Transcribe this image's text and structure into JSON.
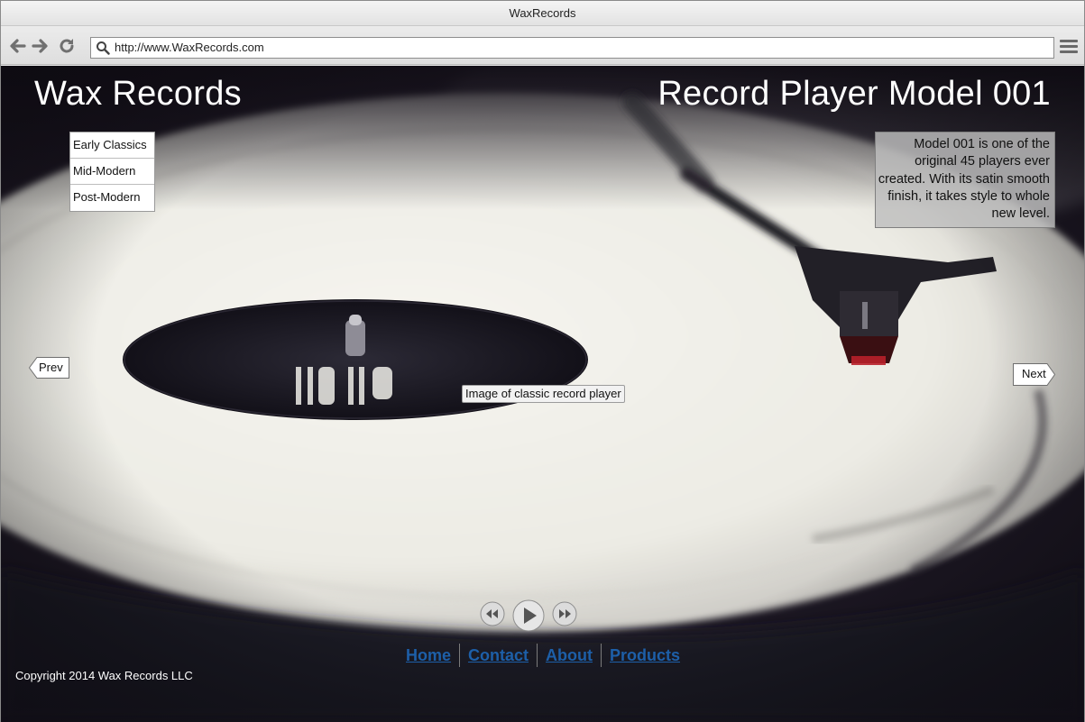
{
  "browser": {
    "window_title": "WaxRecords",
    "url": "http://www.WaxRecords.com",
    "icons": {
      "back": "arrow-left-icon",
      "forward": "arrow-right-icon",
      "reload": "reload-icon",
      "search": "search-icon",
      "menu": "hamburger-menu-icon"
    }
  },
  "site": {
    "title": "Wax Records",
    "product_title": "Record Player Model 001"
  },
  "categories": [
    {
      "label": "Early Classics"
    },
    {
      "label": "Mid-Modern"
    },
    {
      "label": "Post-Modern"
    }
  ],
  "description": "Model 001 is one of the original 45 players ever created.  With its satin smooth finish, it takes style to whole new level.",
  "carousel": {
    "prev_label": "Prev",
    "next_label": "Next",
    "image_caption": "Image of classic record player"
  },
  "media_controls": {
    "rewind_icon": "rewind-icon",
    "play_icon": "play-icon",
    "forward_icon": "fast-forward-icon"
  },
  "footer": {
    "nav": [
      {
        "label": "Home"
      },
      {
        "label": "Contact"
      },
      {
        "label": "About"
      },
      {
        "label": "Products"
      }
    ],
    "copyright": "Copyright 2014 Wax Records LLC"
  },
  "colors": {
    "link": "#1d5fa8",
    "background_dark": "#1d1824",
    "platter": "#efefe9"
  }
}
